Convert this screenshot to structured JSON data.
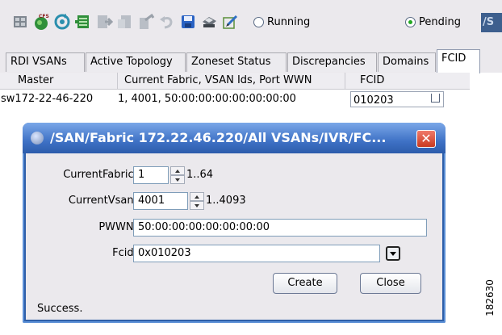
{
  "toolbar": {
    "icons": [
      "grid-back-icon",
      "cfs-icon",
      "refresh-icon",
      "table-icon",
      "export-icon",
      "apply-icon",
      "copy-icon",
      "undo-icon",
      "save-icon",
      "print-icon",
      "edit-icon"
    ],
    "cfs_label": "CFS",
    "running_label": "Running",
    "pending_label": "Pending",
    "vsan_cut_label": "/S",
    "colors": {
      "background": "#ebe9ed",
      "radio_selected": "#22a822"
    }
  },
  "tabs": [
    {
      "label": "RDI VSANs"
    },
    {
      "label": "Active Topology"
    },
    {
      "label": "Zoneset Status"
    },
    {
      "label": "Discrepancies"
    },
    {
      "label": "Domains"
    },
    {
      "label": "FCID"
    }
  ],
  "table": {
    "headers": [
      "Master",
      "Current Fabric, VSAN Ids, Port WWN",
      "FCID"
    ],
    "rows": [
      {
        "master": "sw172-22-46-220",
        "details": "1, 4001, 50:00:00:00:00:00:00:00",
        "fcid": "010203"
      }
    ]
  },
  "dialog": {
    "title": "/SAN/Fabric 172.22.46.220/All VSANs/IVR/FC...",
    "close_glyph": "✕",
    "current_fabric": {
      "label": "CurrentFabric:",
      "value": "1",
      "range": "1..64"
    },
    "current_vsan": {
      "label": "CurrentVsan:",
      "value": "4001",
      "range": "1..4093"
    },
    "pwwn": {
      "label": "PWWN:",
      "value": "50:00:00:00:00:00:00:00"
    },
    "fcid": {
      "label": "Fcid:",
      "value": "0x010203"
    },
    "create_label": "Create",
    "close_label": "Close",
    "status": "Success.",
    "colors": {
      "title_bar": "#3f72c6",
      "close_button": "#c93a20",
      "client": "#ebe9ed"
    }
  },
  "figure_id": "182630"
}
